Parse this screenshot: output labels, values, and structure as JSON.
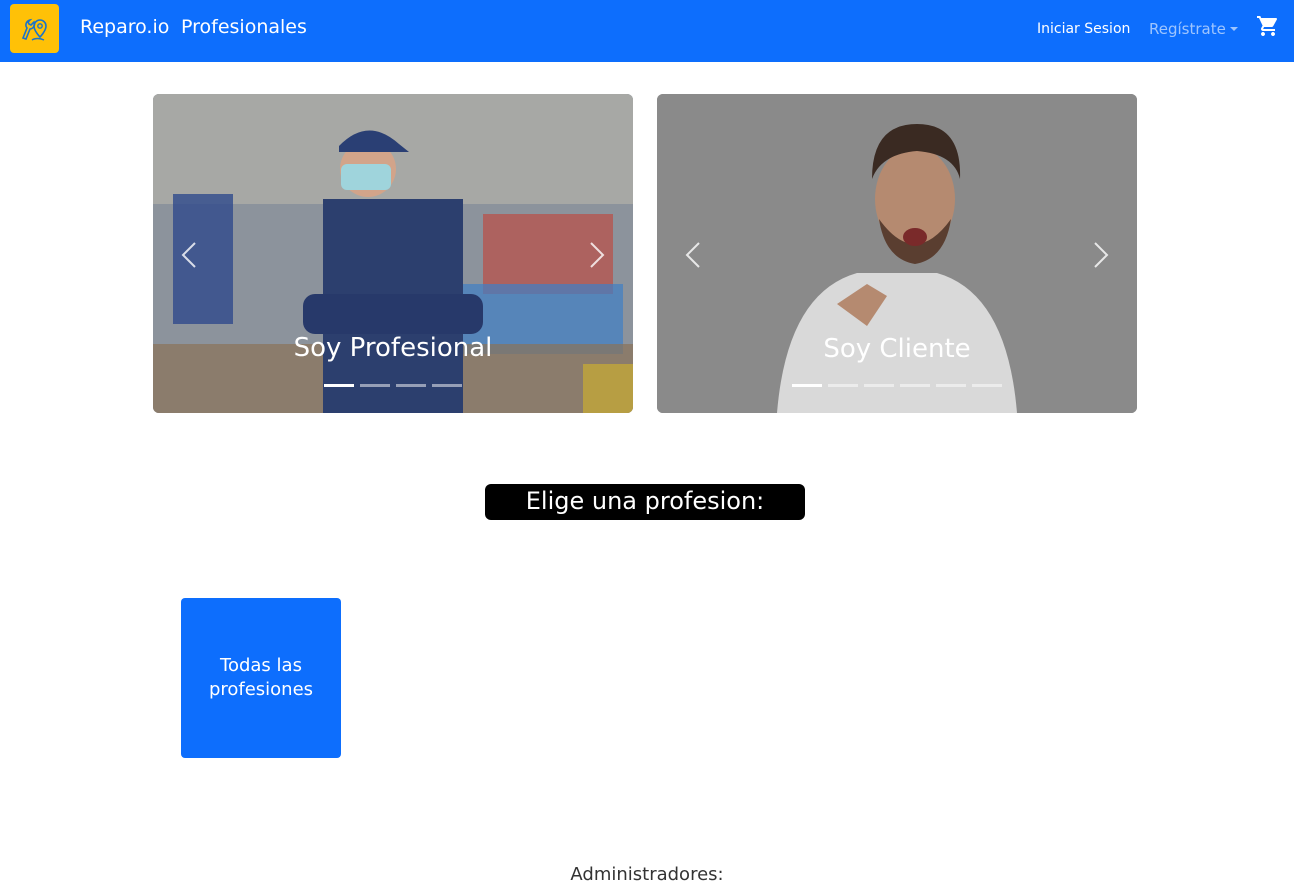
{
  "nav": {
    "brand": "Reparo.io",
    "profesionales": "Profesionales",
    "login": "Iniciar Sesion",
    "register": "Regístrate",
    "cart_icon": "shopping-cart-icon",
    "logo_icon": "wrench-map-pin-logo"
  },
  "carousels": [
    {
      "caption": "Soy Profesional",
      "indicators": 4,
      "active": 0
    },
    {
      "caption": "Soy Cliente",
      "indicators": 6,
      "active": 0
    }
  ],
  "section": {
    "title": "Elige una profesion:"
  },
  "professions": [
    {
      "label": "Todas las profesiones"
    }
  ],
  "footer": {
    "admins": "Administradores:"
  },
  "colors": {
    "primary": "#0d6efd",
    "logo_bg": "#ffc107",
    "title_bg": "#000000"
  }
}
